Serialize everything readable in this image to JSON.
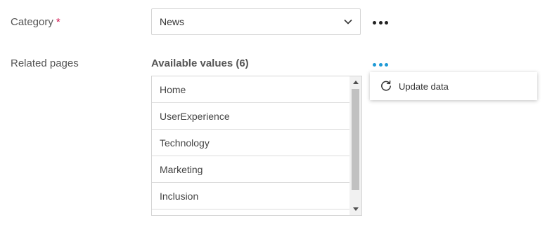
{
  "category": {
    "label": "Category",
    "required_mark": "*",
    "selected": "News"
  },
  "related_pages": {
    "label": "Related pages",
    "available_title": "Available values (6)",
    "items": [
      "Home",
      "UserExperience",
      "Technology",
      "Marketing",
      "Inclusion",
      ""
    ]
  },
  "context_menu": {
    "items": [
      {
        "label": "Update data",
        "icon": "refresh-icon"
      }
    ]
  },
  "colors": {
    "required": "#d0104c",
    "accent_dots": "#1f9ad6"
  }
}
